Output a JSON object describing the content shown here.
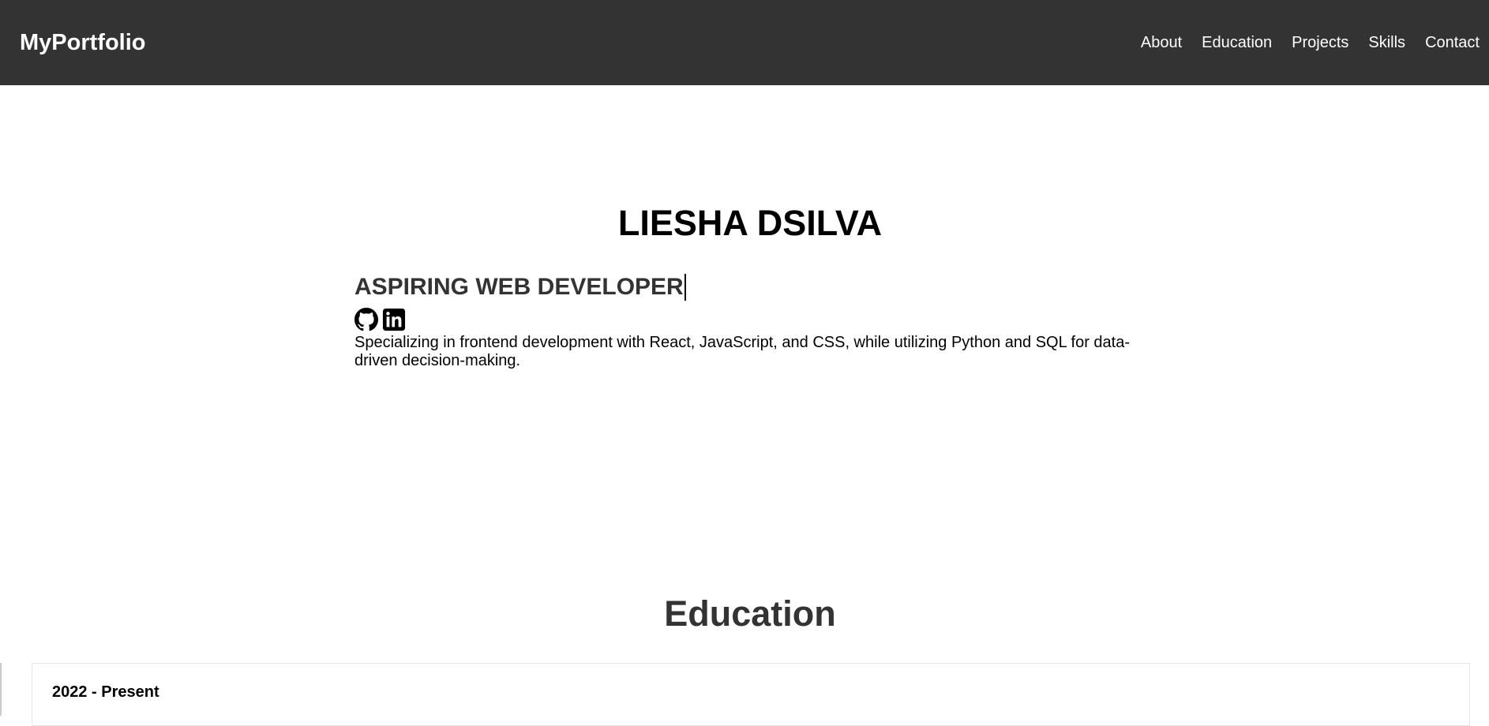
{
  "navbar": {
    "brand": "MyPortfolio",
    "links": [
      "About",
      "Education",
      "Projects",
      "Skills",
      "Contact"
    ]
  },
  "hero": {
    "name": "LIESHA DSILVA",
    "tagline": "ASPIRING WEB DEVELOPER",
    "description": "Specializing in frontend development with React, JavaScript, and CSS, while utilizing Python and SQL for data-driven decision-making.",
    "social_icons": [
      "github-icon",
      "linkedin-icon"
    ]
  },
  "education": {
    "title": "Education",
    "entries": [
      {
        "date": "2022 - Present"
      }
    ]
  },
  "colors": {
    "navbar_bg": "#333333",
    "heading_dark": "#333333",
    "text": "#000000"
  }
}
